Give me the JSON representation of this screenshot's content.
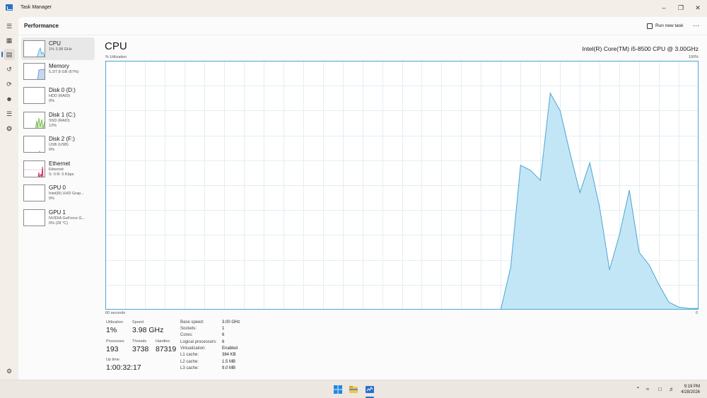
{
  "window": {
    "title": "Task Manager"
  },
  "header": {
    "page": "Performance",
    "run_new_task": "Run new task",
    "more": "⋯"
  },
  "nav_icons": [
    "menu-icon",
    "processes-icon",
    "performance-icon",
    "app-history-icon",
    "startup-icon",
    "users-icon",
    "details-icon",
    "services-icon",
    "settings-icon"
  ],
  "sidebar": {
    "items": [
      {
        "name": "CPU",
        "sub1": "1% 3.98 GHz",
        "sub2": ""
      },
      {
        "name": "Memory",
        "sub1": "5.2/7.8 GB (67%)",
        "sub2": ""
      },
      {
        "name": "Disk 0 (D:)",
        "sub1": "HDD (RAID)",
        "sub2": "0%"
      },
      {
        "name": "Disk 1 (C:)",
        "sub1": "SSD (RAID)",
        "sub2": "12%"
      },
      {
        "name": "Disk 2 (F:)",
        "sub1": "USB (USB)",
        "sub2": "0%"
      },
      {
        "name": "Ethernet",
        "sub1": "Ethernet",
        "sub2": "S: 0 R: 0 Kbps"
      },
      {
        "name": "GPU 0",
        "sub1": "Intel(R) UHD Grap...",
        "sub2": "0%"
      },
      {
        "name": "GPU 1",
        "sub1": "NVIDIA GeForce G...",
        "sub2": "0% (28 °C)"
      }
    ]
  },
  "cpu": {
    "title": "CPU",
    "model": "Intel(R) Core(TM) i5-8500 CPU @ 3.00GHz",
    "y_label": "% Utilization",
    "y_max": "100%",
    "x_left": "60 seconds",
    "x_right": "0"
  },
  "stats": {
    "utilization_label": "Utilization",
    "utilization": "1%",
    "speed_label": "Speed",
    "speed": "3.98 GHz",
    "processes_label": "Processes",
    "processes": "193",
    "threads_label": "Threads",
    "threads": "3738",
    "handles_label": "Handles",
    "handles": "87319",
    "uptime_label": "Up time",
    "uptime": "1:00:32:17"
  },
  "specs": [
    {
      "label": "Base speed:",
      "value": "3.00 GHz"
    },
    {
      "label": "Sockets:",
      "value": "1"
    },
    {
      "label": "Cores:",
      "value": "6"
    },
    {
      "label": "Logical processors:",
      "value": "6"
    },
    {
      "label": "Virtualization:",
      "value": "Enabled"
    },
    {
      "label": "L1 cache:",
      "value": "384 KB"
    },
    {
      "label": "L2 cache:",
      "value": "1.5 MB"
    },
    {
      "label": "L3 cache:",
      "value": "9.0 MB"
    }
  ],
  "chart_data": {
    "type": "area",
    "xlabel": "60 seconds",
    "ylabel": "% Utilization",
    "xlim": [
      60,
      0
    ],
    "ylim": [
      0,
      100
    ],
    "grid": true,
    "series": [
      {
        "x": [
          60,
          20,
          19,
          18,
          17,
          16,
          15,
          14,
          13,
          12,
          11,
          10,
          9,
          8,
          7,
          6,
          5,
          4,
          3,
          2,
          1,
          0
        ],
        "values": [
          0,
          0,
          17,
          58,
          56,
          52,
          87,
          80,
          63,
          47,
          59,
          41,
          16,
          30,
          48,
          23,
          18,
          10,
          3,
          1,
          0.5,
          0.5
        ]
      }
    ],
    "colors": {
      "line": "#4aa6cf",
      "fill": "#c3e6f7"
    }
  },
  "taskbar": {
    "time": "9:19 PM",
    "date": "4/28/2026"
  }
}
